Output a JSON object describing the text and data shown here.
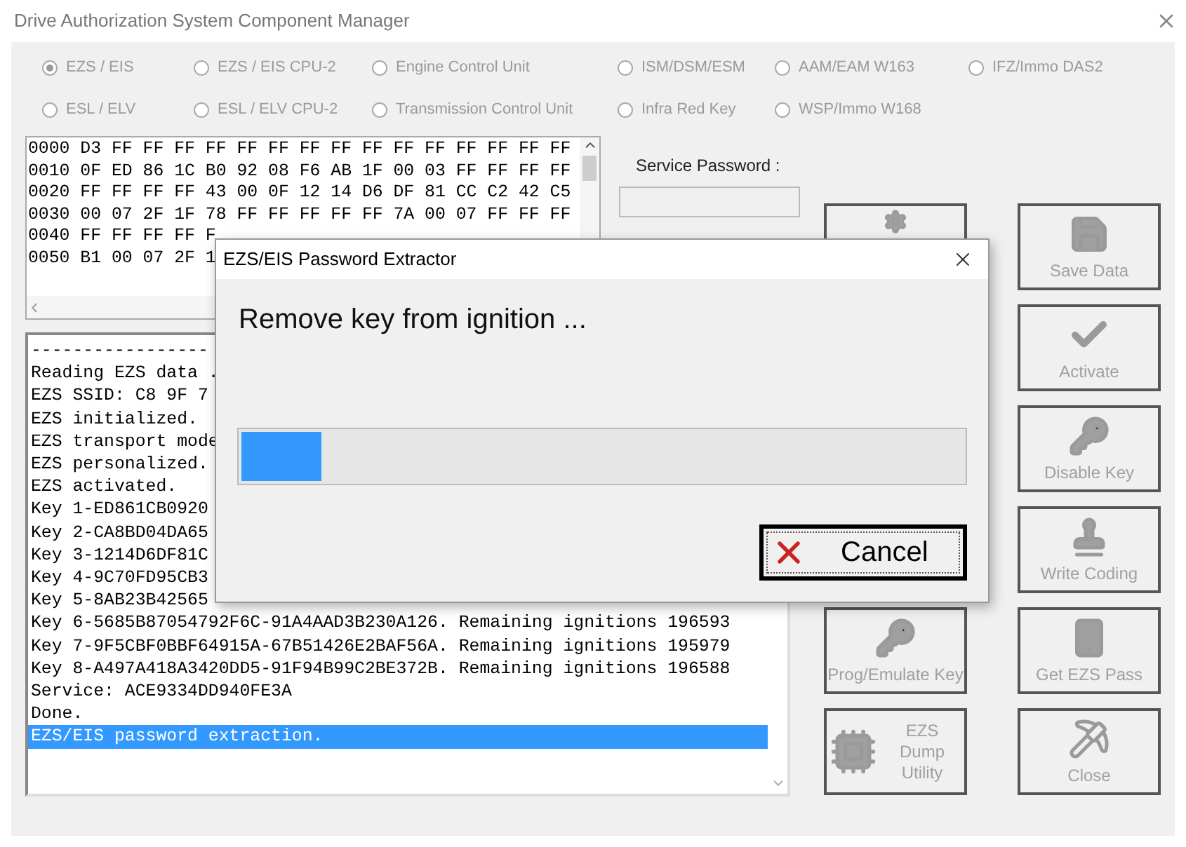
{
  "window": {
    "title": "Drive Authorization System Component Manager"
  },
  "radios": [
    {
      "label": "EZS / EIS",
      "selected": true
    },
    {
      "label": "EZS / EIS CPU-2",
      "selected": false
    },
    {
      "label": "Engine Control Unit",
      "selected": false
    },
    {
      "label": "ISM/DSM/ESM",
      "selected": false
    },
    {
      "label": "AAM/EAM W163",
      "selected": false
    },
    {
      "label": "IFZ/Immo DAS2",
      "selected": false
    },
    {
      "label": "ESL / ELV",
      "selected": false
    },
    {
      "label": "ESL / ELV CPU-2",
      "selected": false
    },
    {
      "label": "Transmission Control Unit",
      "selected": false
    },
    {
      "label": "Infra Red Key",
      "selected": false
    },
    {
      "label": "WSP/Immo W168",
      "selected": false
    }
  ],
  "hex_lines": [
    "0000 D3 FF FF FF FF FF FF FF FF FF FF FF FF FF FF FF",
    "0010 0F ED 86 1C B0 92 08 F6 AB 1F 00 03 FF FF FF FF",
    "0020 FF FF FF FF 43 00 0F 12 14 D6 DF 81 CC C2 42 C5",
    "0030 00 07 2F 1F 78 FF FF FF FF FF 7A 00 07 FF FF FF",
    "0040 FF FF FF FF F",
    "0050 B1 00 07 2F 1"
  ],
  "service_password": {
    "label": "Service Password :"
  },
  "log_lines": [
    {
      "text": "-----------------",
      "selected": false
    },
    {
      "text": "Reading EZS data .",
      "selected": false
    },
    {
      "text": "EZS SSID: C8 9F 7",
      "selected": false
    },
    {
      "text": "EZS initialized.",
      "selected": false
    },
    {
      "text": "EZS transport mode",
      "selected": false
    },
    {
      "text": "EZS personalized.",
      "selected": false
    },
    {
      "text": "EZS activated.",
      "selected": false
    },
    {
      "text": "Key 1-ED861CB0920",
      "selected": false
    },
    {
      "text": "Key 2-CA8BD04DA65",
      "selected": false
    },
    {
      "text": "Key 3-1214D6DF81C",
      "selected": false
    },
    {
      "text": "Key 4-9C70FD95CB3",
      "selected": false
    },
    {
      "text": "Key 5-8AB23B42565",
      "selected": false
    },
    {
      "text": "Key 6-5685B87054792F6C-91A4AAD3B230A126. Remaining ignitions 196593",
      "selected": false
    },
    {
      "text": "Key 7-9F5CBF0BBF64915A-67B51426E2BAF56A. Remaining ignitions 195979",
      "selected": false
    },
    {
      "text": "Key 8-A497A418A3420DD5-91F94B99C2BE372B. Remaining ignitions 196588",
      "selected": false
    },
    {
      "text": "Service: ACE9334DD940FE3A",
      "selected": false
    },
    {
      "text": "Done.",
      "selected": false
    },
    {
      "text": "EZS/EIS password extraction.",
      "selected": true
    }
  ],
  "left_buttons": [
    {
      "kind": "gear"
    },
    {
      "kind": "fob",
      "label": "Prog/Emulate Key"
    },
    {
      "kind": "chip",
      "label": "EZS Dump Utility"
    }
  ],
  "right_buttons": [
    {
      "kind": "save",
      "label": "Save Data"
    },
    {
      "kind": "check",
      "label": "Activate"
    },
    {
      "kind": "key",
      "label": "Disable Key"
    },
    {
      "kind": "stamp",
      "label": "Write Coding"
    },
    {
      "kind": "card",
      "label": "Get EZS Pass"
    },
    {
      "kind": "pick",
      "label": "Close"
    }
  ],
  "dialog": {
    "title": "EZS/EIS Password Extractor",
    "message": "Remove key from ignition ...",
    "progress": {
      "level": 0.11
    },
    "cancel_button": "Cancel"
  }
}
